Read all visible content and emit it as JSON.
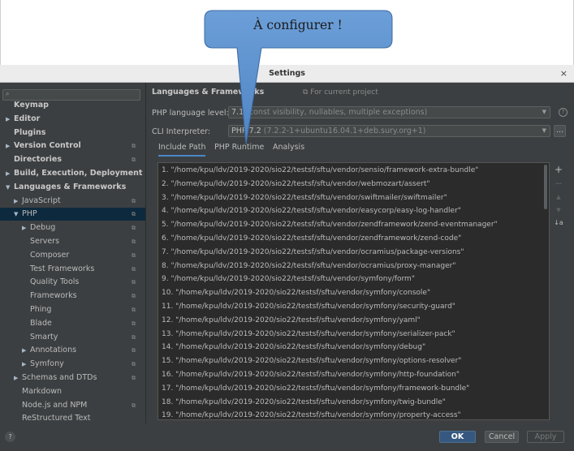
{
  "dialog": {
    "title": "Settings",
    "close_glyph": "×"
  },
  "callout": {
    "text": "À configurer !"
  },
  "search": {
    "icon": "search-icon"
  },
  "sidebar": {
    "items": [
      {
        "label": "Keymap",
        "indent": 0,
        "arrow": "",
        "bold": true,
        "copy": false,
        "selected": false
      },
      {
        "label": "Editor",
        "indent": 0,
        "arrow": "▶",
        "bold": true,
        "copy": false,
        "selected": false
      },
      {
        "label": "Plugins",
        "indent": 0,
        "arrow": "",
        "bold": true,
        "copy": false,
        "selected": false
      },
      {
        "label": "Version Control",
        "indent": 0,
        "arrow": "▶",
        "bold": true,
        "copy": true,
        "selected": false
      },
      {
        "label": "Directories",
        "indent": 0,
        "arrow": "",
        "bold": true,
        "copy": true,
        "selected": false
      },
      {
        "label": "Build, Execution, Deployment",
        "indent": 0,
        "arrow": "▶",
        "bold": true,
        "copy": false,
        "selected": false
      },
      {
        "label": "Languages & Frameworks",
        "indent": 0,
        "arrow": "▼",
        "bold": true,
        "copy": false,
        "selected": false
      },
      {
        "label": "JavaScript",
        "indent": 1,
        "arrow": "▶",
        "bold": false,
        "copy": true,
        "selected": false
      },
      {
        "label": "PHP",
        "indent": 1,
        "arrow": "▼",
        "bold": false,
        "copy": true,
        "selected": true
      },
      {
        "label": "Debug",
        "indent": 2,
        "arrow": "▶",
        "bold": false,
        "copy": true,
        "selected": false
      },
      {
        "label": "Servers",
        "indent": 2,
        "arrow": "",
        "bold": false,
        "copy": true,
        "selected": false
      },
      {
        "label": "Composer",
        "indent": 2,
        "arrow": "",
        "bold": false,
        "copy": true,
        "selected": false
      },
      {
        "label": "Test Frameworks",
        "indent": 2,
        "arrow": "",
        "bold": false,
        "copy": true,
        "selected": false
      },
      {
        "label": "Quality Tools",
        "indent": 2,
        "arrow": "",
        "bold": false,
        "copy": true,
        "selected": false
      },
      {
        "label": "Frameworks",
        "indent": 2,
        "arrow": "",
        "bold": false,
        "copy": true,
        "selected": false
      },
      {
        "label": "Phing",
        "indent": 2,
        "arrow": "",
        "bold": false,
        "copy": true,
        "selected": false
      },
      {
        "label": "Blade",
        "indent": 2,
        "arrow": "",
        "bold": false,
        "copy": true,
        "selected": false
      },
      {
        "label": "Smarty",
        "indent": 2,
        "arrow": "",
        "bold": false,
        "copy": true,
        "selected": false
      },
      {
        "label": "Annotations",
        "indent": 2,
        "arrow": "▶",
        "bold": false,
        "copy": true,
        "selected": false
      },
      {
        "label": "Symfony",
        "indent": 2,
        "arrow": "▶",
        "bold": false,
        "copy": true,
        "selected": false
      },
      {
        "label": "Schemas and DTDs",
        "indent": 1,
        "arrow": "▶",
        "bold": false,
        "copy": true,
        "selected": false
      },
      {
        "label": "Markdown",
        "indent": 1,
        "arrow": "",
        "bold": false,
        "copy": false,
        "selected": false
      },
      {
        "label": "Node.js and NPM",
        "indent": 1,
        "arrow": "",
        "bold": false,
        "copy": true,
        "selected": false
      },
      {
        "label": "ReStructured Text",
        "indent": 1,
        "arrow": "",
        "bold": false,
        "copy": false,
        "selected": false
      }
    ],
    "copy_glyph": "⧉"
  },
  "main": {
    "header": "Languages & Frameworks",
    "scope": "⧉ For current project",
    "php_level_label": "PHP language level:",
    "php_level_value": "7.1",
    "php_level_desc": "(const visibility, nullables, multiple exceptions)",
    "cli_label": "CLI Interpreter:",
    "cli_value": "PHP 7.2",
    "cli_desc": "(7.2.2-1+ubuntu16.04.1+deb.sury.org+1)",
    "dots": "...",
    "help": "?",
    "tabs": [
      "Include Path",
      "PHP Runtime",
      "Analysis"
    ],
    "include_paths": [
      "1. \"/home/kpu/ldv/2019-2020/sio22/testsf/sftu/vendor/sensio/framework-extra-bundle\"",
      "2. \"/home/kpu/ldv/2019-2020/sio22/testsf/sftu/vendor/webmozart/assert\"",
      "3. \"/home/kpu/ldv/2019-2020/sio22/testsf/sftu/vendor/swiftmailer/swiftmailer\"",
      "4. \"/home/kpu/ldv/2019-2020/sio22/testsf/sftu/vendor/easycorp/easy-log-handler\"",
      "5. \"/home/kpu/ldv/2019-2020/sio22/testsf/sftu/vendor/zendframework/zend-eventmanager\"",
      "6. \"/home/kpu/ldv/2019-2020/sio22/testsf/sftu/vendor/zendframework/zend-code\"",
      "7. \"/home/kpu/ldv/2019-2020/sio22/testsf/sftu/vendor/ocramius/package-versions\"",
      "8. \"/home/kpu/ldv/2019-2020/sio22/testsf/sftu/vendor/ocramius/proxy-manager\"",
      "9. \"/home/kpu/ldv/2019-2020/sio22/testsf/sftu/vendor/symfony/form\"",
      "10. \"/home/kpu/ldv/2019-2020/sio22/testsf/sftu/vendor/symfony/console\"",
      "11. \"/home/kpu/ldv/2019-2020/sio22/testsf/sftu/vendor/symfony/security-guard\"",
      "12. \"/home/kpu/ldv/2019-2020/sio22/testsf/sftu/vendor/symfony/yaml\"",
      "13. \"/home/kpu/ldv/2019-2020/sio22/testsf/sftu/vendor/symfony/serializer-pack\"",
      "14. \"/home/kpu/ldv/2019-2020/sio22/testsf/sftu/vendor/symfony/debug\"",
      "15. \"/home/kpu/ldv/2019-2020/sio22/testsf/sftu/vendor/symfony/options-resolver\"",
      "16. \"/home/kpu/ldv/2019-2020/sio22/testsf/sftu/vendor/symfony/http-foundation\"",
      "17. \"/home/kpu/ldv/2019-2020/sio22/testsf/sftu/vendor/symfony/framework-bundle\"",
      "18. \"/home/kpu/ldv/2019-2020/sio22/testsf/sftu/vendor/symfony/twig-bundle\"",
      "19. \"/home/kpu/ldv/2019-2020/sio22/testsf/sftu/vendor/symfony/property-access\""
    ],
    "tools": {
      "add": "+",
      "remove": "−",
      "up": "▲",
      "down": "▼",
      "sort": "↓a"
    }
  },
  "footer": {
    "help": "?",
    "ok": "OK",
    "cancel": "Cancel",
    "apply": "Apply"
  },
  "colors": {
    "dialog_bg": "#3c3f41",
    "selection": "#0d293e",
    "ok_bg": "#365880",
    "callout_fill": "#5b8fcf"
  }
}
